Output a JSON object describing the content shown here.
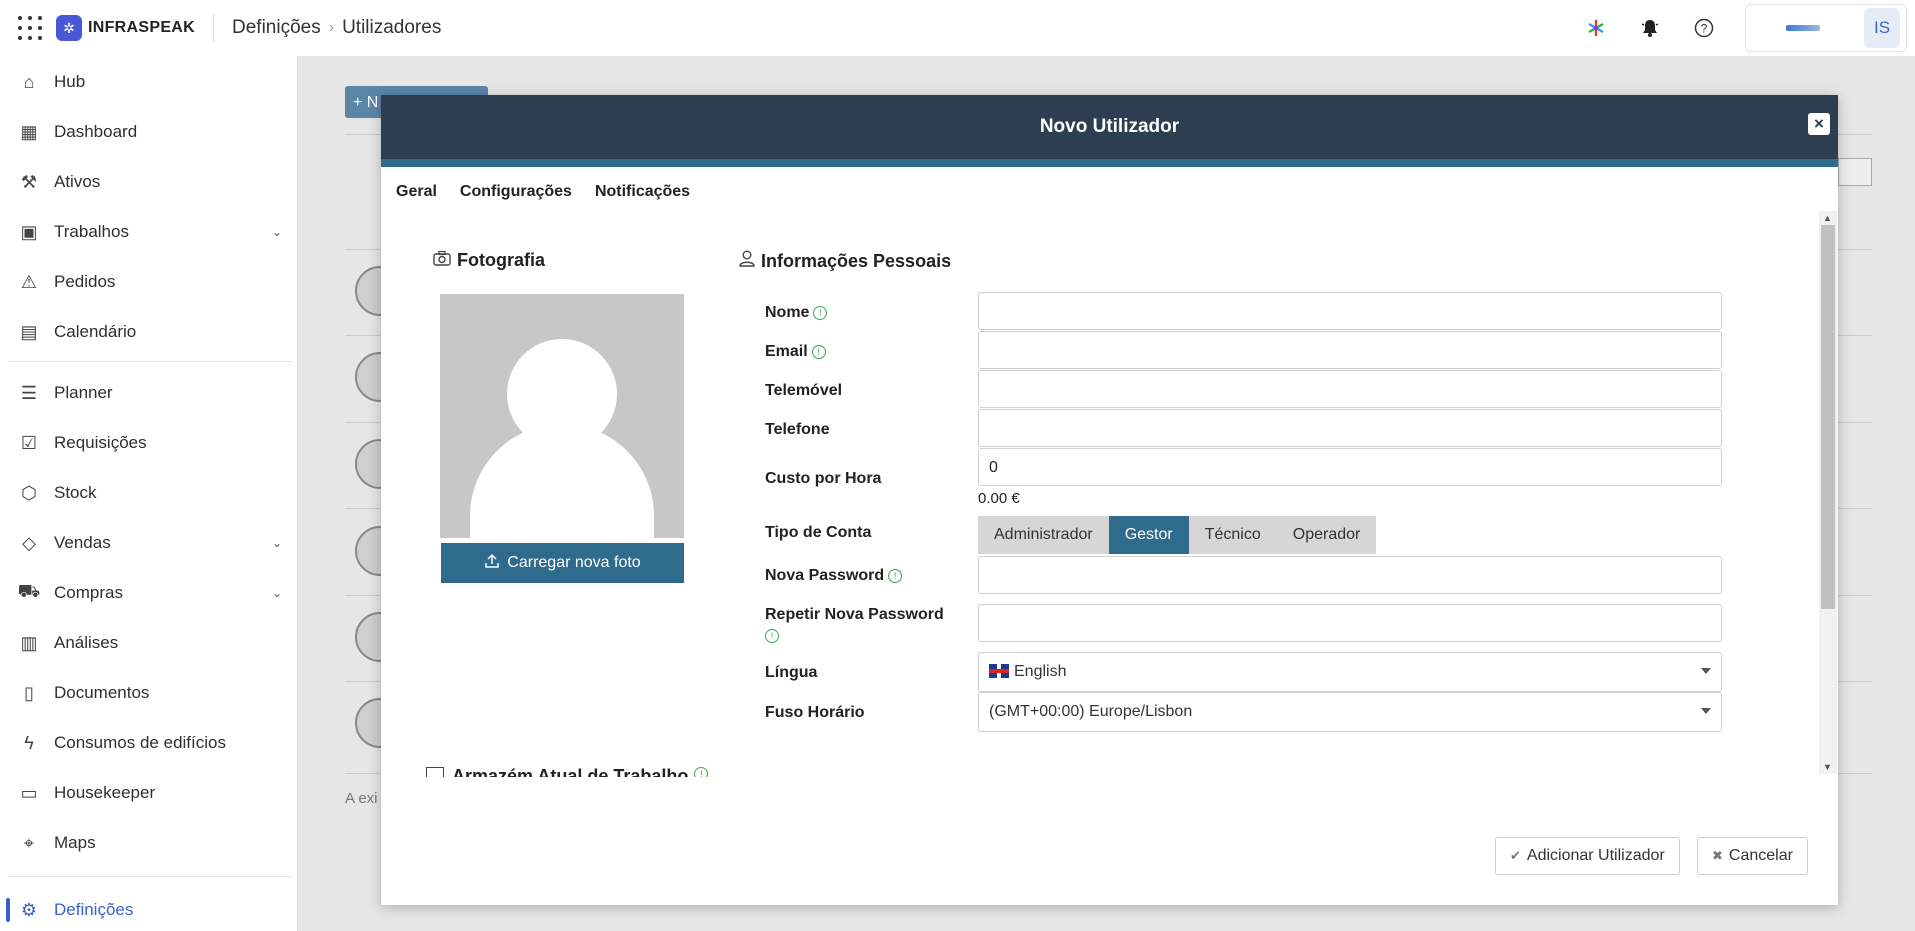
{
  "app": {
    "brand": "INFRASPEAK"
  },
  "breadcrumb": [
    "Definições",
    "Utilizadores"
  ],
  "topbar": {
    "avatar_initials": "IS"
  },
  "sidebar": {
    "items": [
      {
        "label": "Hub",
        "icon": "home-icon"
      },
      {
        "label": "Dashboard",
        "icon": "dashboard-icon"
      },
      {
        "label": "Ativos",
        "icon": "wrench-icon"
      },
      {
        "label": "Trabalhos",
        "icon": "briefcase-icon",
        "expandable": true
      },
      {
        "label": "Pedidos",
        "icon": "warning-icon"
      },
      {
        "label": "Calendário",
        "icon": "calendar-icon"
      },
      {
        "label": "Planner",
        "icon": "planner-icon"
      },
      {
        "label": "Requisições",
        "icon": "checklist-icon"
      },
      {
        "label": "Stock",
        "icon": "box-icon"
      },
      {
        "label": "Vendas",
        "icon": "tag-icon",
        "expandable": true
      },
      {
        "label": "Compras",
        "icon": "cart-icon",
        "expandable": true
      },
      {
        "label": "Análises",
        "icon": "chart-icon"
      },
      {
        "label": "Documentos",
        "icon": "document-icon"
      },
      {
        "label": "Consumos de edifícios",
        "icon": "bolt-icon"
      },
      {
        "label": "Housekeeper",
        "icon": "bed-icon"
      },
      {
        "label": "Maps",
        "icon": "map-pin-icon"
      },
      {
        "label": "Definições",
        "icon": "gear-icon",
        "active": true
      }
    ]
  },
  "background": {
    "new_button": "+ N",
    "footer_text": "A exi"
  },
  "modal": {
    "title": "Novo Utilizador",
    "tabs": [
      "Geral",
      "Configurações",
      "Notificações"
    ],
    "photo_section": "Fotografia",
    "upload_button": "Carregar nova foto",
    "personal_section": "Informações Pessoais",
    "fields": {
      "name_label": "Nome",
      "email_label": "Email",
      "mobile_label": "Telemóvel",
      "phone_label": "Telefone",
      "cost_label": "Custo por Hora",
      "cost_value": "0",
      "cost_formatted": "0.00 €",
      "account_type_label": "Tipo de Conta",
      "account_types": [
        "Administrador",
        "Gestor",
        "Técnico",
        "Operador"
      ],
      "account_type_selected": "Gestor",
      "new_password_label": "Nova Password",
      "repeat_password_label": "Repetir Nova Password",
      "language_label": "Língua",
      "language_value": "English",
      "timezone_label": "Fuso Horário",
      "timezone_value": "(GMT+00:00) Europe/Lisbon"
    },
    "partial_section": "Armazém Atual de Trabalho",
    "add_button": "Adicionar Utilizador",
    "cancel_button": "Cancelar"
  },
  "colors": {
    "header": "#2c3e50",
    "accent": "#2e6b8c",
    "nav_active": "#3b5fd0",
    "info": "#3aa55a"
  }
}
